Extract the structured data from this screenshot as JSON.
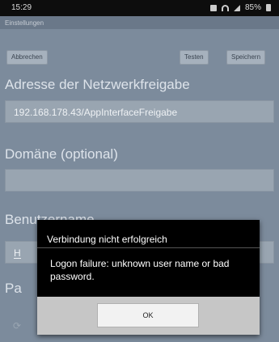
{
  "status_bar": {
    "time": "15:29",
    "battery": "85%"
  },
  "title_bar": {
    "title": "Einstellungen"
  },
  "toolbar": {
    "cancel_label": "Abbrechen",
    "test_label": "Testen",
    "save_label": "Speichern"
  },
  "form": {
    "address_label": "Adresse der Netzwerkfreigabe",
    "address_value": "192.168.178.43/AppInterfaceFreigabe",
    "domain_label": "Domäne (optional)",
    "domain_value": "",
    "user_label": "Benutzername",
    "user_value": "H",
    "password_label": "Pa"
  },
  "dialog": {
    "title": "Verbindung nicht erfolgreich",
    "message": "Logon failure: unknown user name or bad password.",
    "ok_label": "OK"
  },
  "colors": {
    "background": "#7c8b9c",
    "dialog": "#000000",
    "dialog_footer": "#c6c6c6"
  },
  "icons": [
    "notification-icon",
    "wifi-icon",
    "signal-icon",
    "battery-icon",
    "sync-icon"
  ]
}
